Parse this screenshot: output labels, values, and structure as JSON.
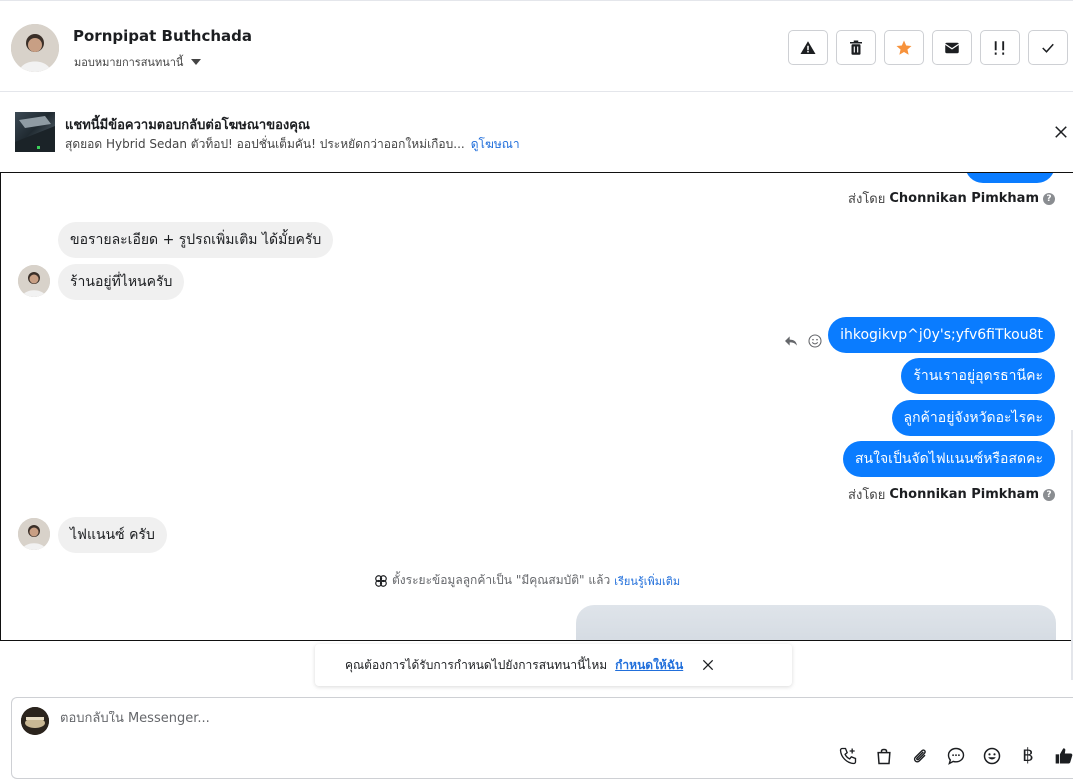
{
  "header": {
    "name": "Pornpipat Buthchada",
    "assign_label": "มอบหมายการสนทนานี้",
    "actions": [
      "report-icon",
      "trash-icon",
      "star-icon",
      "mail-icon",
      "follow-up-icon",
      "check-icon"
    ],
    "star_color": "#f7923b"
  },
  "ad_banner": {
    "title": "แชทนี้มีข้อความตอบกลับต่อโฆษณาของคุณ",
    "description": "สุดยอด Hybrid Sedan ตัวท็อป! ออปชั่นเต็มคัน! ประหยัดกว่าออกใหม่เกือบ...",
    "link": "ดูโฆษณา"
  },
  "chat": {
    "sender_prefix": "ส่งโดย",
    "sender_name": "Chonnikan Pimkham",
    "incoming": [
      "ขอรายละเอียด + รูปรถเพิ่มเติม ได้มั้ยครับ",
      "ร้านอยู่ที่ไหนครับ",
      "ไฟแนนซ์ ครับ"
    ],
    "outgoing": [
      "ihkogikvp^j0y's;yfv6fiTkou8t",
      "ร้านเราอยู่อุดรธานีคะ",
      "ลูกค้าอยู่จังหวัดอะไรคะ",
      "สนใจเป็นจัดไฟแนนซ์หรือสดคะ"
    ],
    "outgoing_color": "#0a7cff",
    "system_note": "ตั้งระยะข้อมูลลูกค้าเป็น \"มีคุณสมบัติ\" แล้ว",
    "system_link": "เรียนรู้เพิ่มเติม"
  },
  "toast": {
    "text": "คุณต้องการได้รับการกำหนดไปยังการสนทนานี้ไหม",
    "link": "กำหนดให้ฉัน"
  },
  "composer": {
    "placeholder": "ตอบกลับใน Messenger...",
    "tools": [
      "call-icon",
      "shopping-bag-icon",
      "attachment-icon",
      "chat-bubble-icon",
      "emoji-icon",
      "baht-icon",
      "like-icon"
    ],
    "baht_symbol": "฿"
  }
}
